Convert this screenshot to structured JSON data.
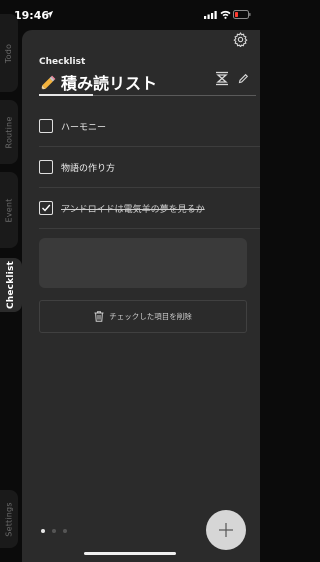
{
  "status_bar": {
    "time": "19:46"
  },
  "side_tabs": [
    {
      "label": "Todo"
    },
    {
      "label": "Routine"
    },
    {
      "label": "Event"
    },
    {
      "label": "Checklist"
    },
    {
      "label": "Settings"
    }
  ],
  "header": {
    "list_label": "Checklist",
    "title": "積み読リスト"
  },
  "items": [
    {
      "text": "ハーモニー",
      "checked": false
    },
    {
      "text": "物語の作り方",
      "checked": false
    },
    {
      "text": "アンドロイドは電気羊の夢を見るか",
      "checked": true
    }
  ],
  "delete_checked_label": "チェックした項目を削除",
  "pager": {
    "count": 3,
    "active": 0
  },
  "icons": {
    "location": "location-arrow-icon",
    "settings": "gear-icon",
    "sort": "sort-icon",
    "edit": "pencil-icon",
    "delete": "trash-icon",
    "add": "plus-icon"
  },
  "colors": {
    "background": "#0b0b0b",
    "panel": "#2b2b2b",
    "battery_low": "#ff3b30"
  }
}
